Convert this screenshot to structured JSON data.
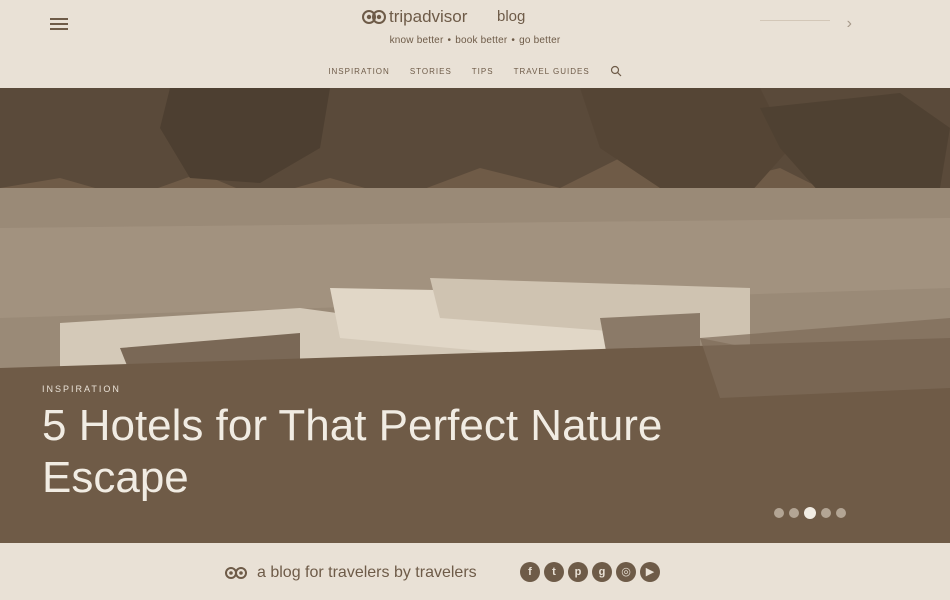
{
  "header": {
    "brand": "tripadvisor",
    "blog_label": "blog",
    "tagline_parts": [
      "know better",
      "book better",
      "go better"
    ],
    "tagline_sep": "•",
    "nav": [
      "INSPIRATION",
      "STORIES",
      "TIPS",
      "TRAVEL GUIDES"
    ]
  },
  "hero": {
    "category": "INSPIRATION",
    "title": "5 Hotels for That Perfect Nature Escape",
    "slides": 5,
    "active_slide": 3
  },
  "footer": {
    "text": "a blog for travelers by travelers",
    "socials": [
      "facebook-icon",
      "twitter-icon",
      "pinterest-icon",
      "google-plus-icon",
      "instagram-icon",
      "youtube-icon"
    ]
  },
  "colors": {
    "background": "#e9e1d6",
    "text": "#6e5b48",
    "hero_overlay": "#6f5b47",
    "hero_text": "#f1ece3"
  }
}
